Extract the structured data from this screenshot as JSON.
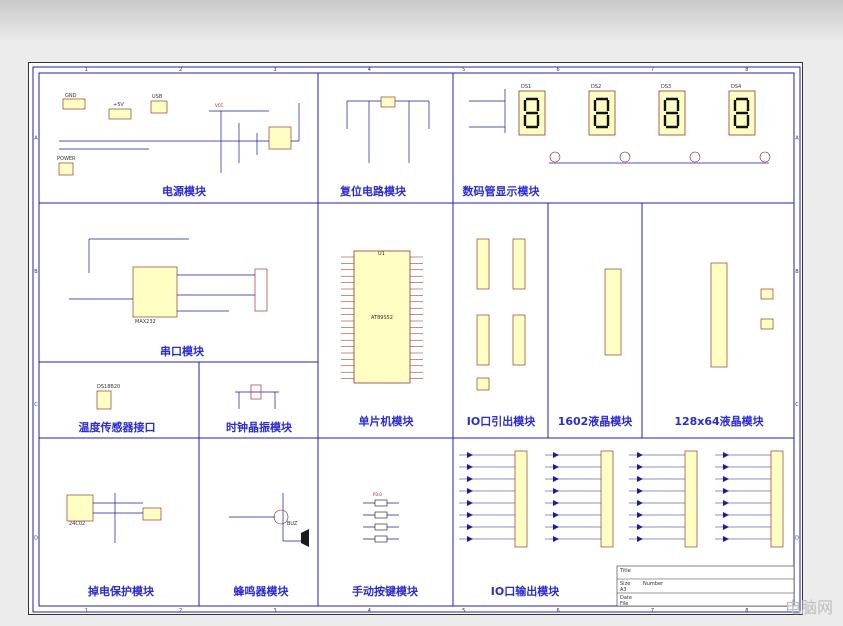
{
  "watermark": "电脑网",
  "grid_cols": [
    "1",
    "2",
    "3",
    "4",
    "5",
    "6",
    "7",
    "8"
  ],
  "grid_rows": [
    "A",
    "B",
    "C",
    "D"
  ],
  "modules": {
    "power": "电源模块",
    "reset": "复位电路模块",
    "display": "数码管显示模块",
    "uart": "串口模块",
    "mcu": "单片机模块",
    "io_out": "IO口引出模块",
    "lcd1602": "1602液晶模块",
    "lcd12864": "128x64液晶模块",
    "temp": "温度传感器接口",
    "clock": "时钟晶振模块",
    "eeprom": "掉电保护模块",
    "buzzer": "蜂鸣器模块",
    "keys": "手动按键模块",
    "io_led": "IO口输出模块"
  },
  "parts": {
    "gnd": "GND",
    "vcc5": "+5V",
    "usb": "USB",
    "vcc": "VCC",
    "power": "POWER",
    "mcu": "U1",
    "mcu_chip": "AT89S52",
    "max": "MAX232",
    "ds": "DS18B20",
    "eeprom": "24C02",
    "buzzer": "BUZ",
    "key": "P3.0",
    "seg": [
      "DS1",
      "DS2",
      "DS3",
      "DS4"
    ],
    "title_block": [
      "Title",
      "Size",
      "Number",
      "A3",
      "Date",
      "File"
    ]
  },
  "colors": {
    "frame": "#2020b0",
    "wire": "#1a1aa0",
    "part_fill": "#ffffc4",
    "part_stroke": "#8a1a1a",
    "title": "#2b2bd6"
  }
}
